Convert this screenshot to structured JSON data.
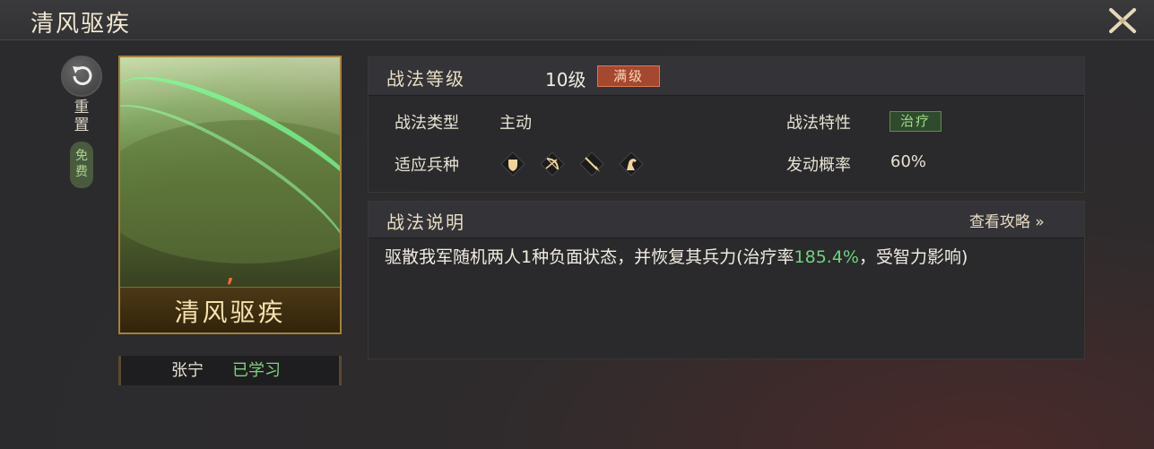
{
  "window": {
    "title": "清风驱疾"
  },
  "side": {
    "reset_label": "重置",
    "free_label": "免费"
  },
  "card": {
    "name": "清风驱疾",
    "emblem": "⸴"
  },
  "owner": {
    "name": "张宁",
    "status": "已学习"
  },
  "stats": {
    "level_label": "战法等级",
    "level_value": "10级",
    "max_badge": "满级",
    "type_label": "战法类型",
    "type_value": "主动",
    "trait_label": "战法特性",
    "trait_value": "治疗",
    "units_label": "适应兵种",
    "units": [
      "shield-icon",
      "bow-icon",
      "spear-icon",
      "horse-icon"
    ],
    "rate_label": "发动概率",
    "rate_value": "60%"
  },
  "description": {
    "header": "战法说明",
    "guide_link": "查看攻略 »",
    "text_before": "驱散我军随机两人1种负面状态，并恢复其兵力(治疗率",
    "highlight": "185.4%",
    "text_after": "，受智力影响)"
  },
  "colors": {
    "accent_gold": "#a5803a",
    "highlight_green": "#6fd480",
    "badge_red": "#a5482f"
  }
}
